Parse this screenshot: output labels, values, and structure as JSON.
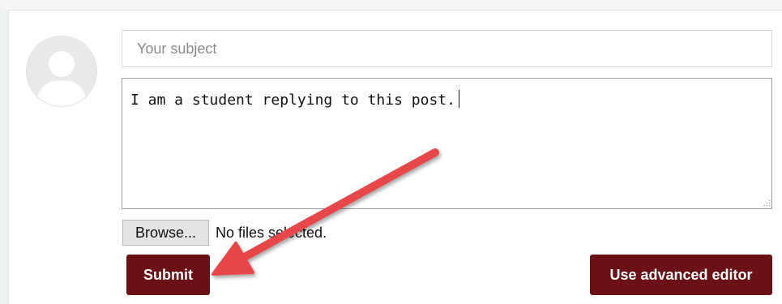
{
  "reply_form": {
    "subject_placeholder": "Your subject",
    "subject_value": "",
    "message_text": "I am a student replying to this post.",
    "browse_label": "Browse...",
    "file_status": "No files selected.",
    "submit_label": "Submit",
    "advanced_editor_label": "Use advanced editor"
  },
  "colors": {
    "button_background": "#6b1014",
    "annotation_arrow": "#e8474a"
  },
  "icons": {
    "avatar": "default-user-avatar-icon",
    "annotation": "red-arrow-pointing-to-submit"
  }
}
